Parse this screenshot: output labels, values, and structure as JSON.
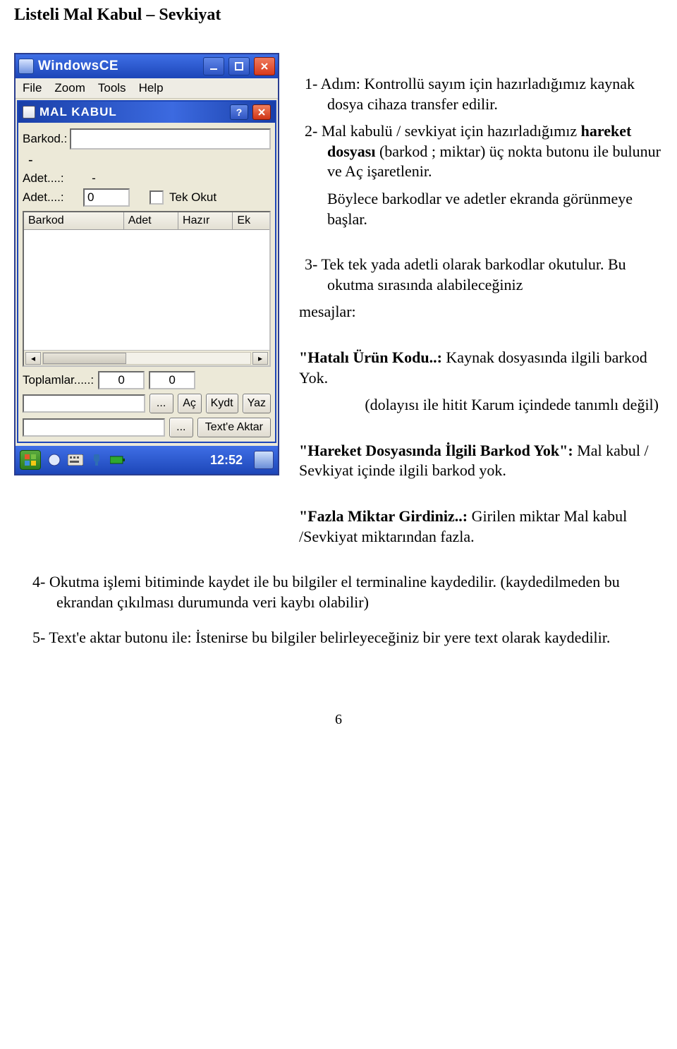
{
  "page": {
    "title": "Listeli Mal Kabul – Sevkiyat",
    "page_number": "6"
  },
  "ce": {
    "title": "WindowsCE",
    "menu": [
      "File",
      "Zoom",
      "Tools",
      "Help"
    ]
  },
  "app": {
    "title": "MAL KABUL",
    "labels": {
      "barkod": "Barkod.:",
      "adet1": "Adet....:",
      "adet1_value": "-",
      "adet2": "Adet....:",
      "adet2_value": "0",
      "tek_okut": "Tek Okut",
      "toplamlar": "Toplamlar.....:",
      "toplam1": "0",
      "toplam2": "0"
    },
    "table_headers": [
      "Barkod",
      "Adet",
      "Hazır",
      "Ek"
    ],
    "buttons": {
      "more1": "...",
      "ac": "Aç",
      "kydt": "Kydt",
      "yaz": "Yaz",
      "more2": "...",
      "text_aktar": "Text'e Aktar"
    }
  },
  "taskbar": {
    "clock": "12:52"
  },
  "doc": {
    "step1": "1-  Adım: Kontrollü sayım için hazırladığımız kaynak dosya cihaza transfer edilir.",
    "step2a": "2-  Mal kabulü / sevkiyat için hazırladığımız ",
    "step2b_bold": "hareket dosyası",
    "step2c": " (barkod ; miktar) üç nokta butonu ile bulunur ve Aç işaretlenir.",
    "step2_follow": "Böylece barkodlar ve adetler ekranda görünmeye başlar.",
    "step3": "3-  Tek tek yada adetli olarak barkodlar okutulur. Bu okutma sırasında alabileceğiniz",
    "step3_mesaj": "mesajlar:",
    "msg1a_bold": "\"Hatalı Ürün Kodu..:",
    "msg1b": " Kaynak dosyasında ilgili barkod Yok.",
    "msg1c": "(dolayısı ile hitit Karum içindede tanımlı değil)",
    "msg2a_bold": "\"Hareket Dosyasında İlgili Barkod Yok\":",
    "msg2b": " Mal kabul / Sevkiyat içinde ilgili barkod yok.",
    "msg3a_bold": "\"Fazla Miktar Girdiniz..:",
    "msg3b": " Girilen miktar Mal kabul /Sevkiyat  miktarından fazla.",
    "step4": "4-  Okutma işlemi bitiminde kaydet ile bu bilgiler el terminaline kaydedilir. (kaydedilmeden bu ekrandan çıkılması durumunda veri kaybı olabilir)",
    "step5": "5-  Text'e aktar butonu ile: İstenirse bu bilgiler belirleyeceğiniz bir yere text olarak kaydedilir."
  }
}
